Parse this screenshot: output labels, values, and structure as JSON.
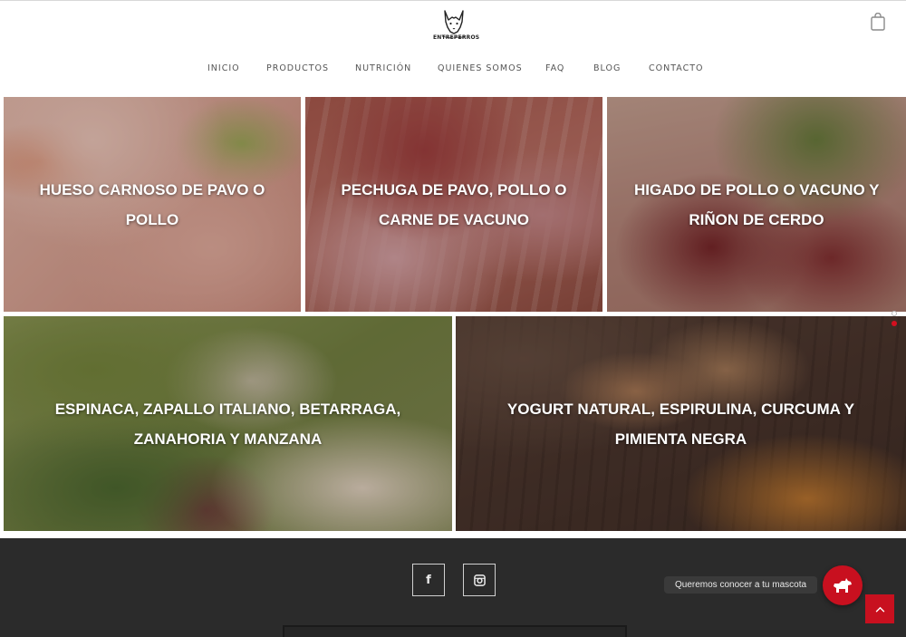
{
  "header": {
    "logo_text": "ENTREPERROS",
    "cart_icon": "shopping-bag-icon"
  },
  "nav": {
    "items": [
      {
        "label": "INICIO"
      },
      {
        "label": "PRODUCTOS"
      },
      {
        "label": "NUTRICIÓN"
      },
      {
        "label": "QUIENES SOMOS"
      },
      {
        "label": "FAQ"
      },
      {
        "label": "BLOG"
      },
      {
        "label": "CONTACTO"
      }
    ]
  },
  "tiles": [
    {
      "line1": "HUESO CARNOSO DE PAVO O",
      "line2": "POLLO"
    },
    {
      "line1": "PECHUGA DE PAVO, POLLO O",
      "line2": "CARNE DE VACUNO"
    },
    {
      "line1": "HIGADO DE POLLO O VACUNO Y",
      "line2": "RIÑON DE CERDO"
    },
    {
      "line1": "ESPINACA, ZAPALLO ITALIANO, BETARRAGA,",
      "line2": "ZANAHORIA Y MANZANA"
    },
    {
      "line1": "YOGURT NATURAL, ESPIRULINA, CURCUMA Y",
      "line2": "PIMIENTA NEGRA"
    }
  ],
  "footer": {
    "social": [
      {
        "icon": "facebook-icon",
        "glyph": "f"
      },
      {
        "icon": "instagram-icon"
      }
    ]
  },
  "widget": {
    "pet_label": "Queremos conocer a tu mascota",
    "pet_icon": "dog-icon",
    "scroll_icon": "chevron-up-icon"
  },
  "colors": {
    "accent": "#c8101f",
    "footer_bg": "#2b2b2b",
    "nav_text": "#555555"
  }
}
